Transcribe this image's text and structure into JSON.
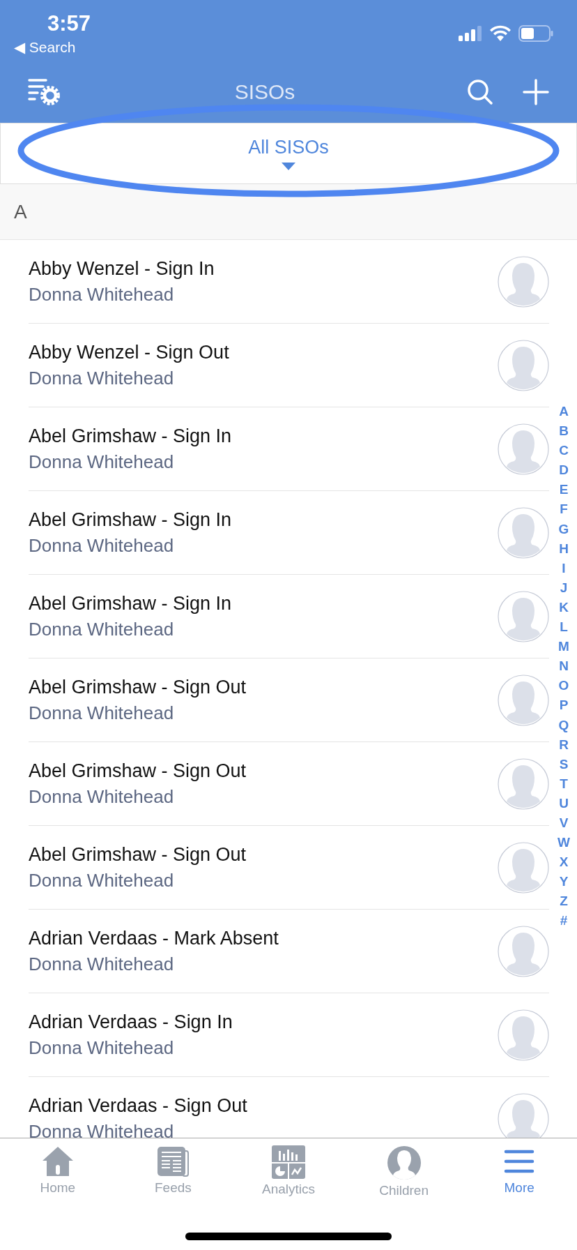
{
  "status_bar": {
    "time": "3:57",
    "back_label": "◀ Search"
  },
  "nav_bar": {
    "title": "SISOs"
  },
  "filter": {
    "label": "All SISOs"
  },
  "section": {
    "letter": "A"
  },
  "rows": [
    {
      "title": "Abby Wenzel - Sign In",
      "subtitle": "Donna Whitehead"
    },
    {
      "title": "Abby Wenzel - Sign Out",
      "subtitle": "Donna Whitehead"
    },
    {
      "title": "Abel Grimshaw - Sign In",
      "subtitle": "Donna Whitehead"
    },
    {
      "title": "Abel Grimshaw - Sign In",
      "subtitle": "Donna Whitehead"
    },
    {
      "title": "Abel Grimshaw - Sign In",
      "subtitle": "Donna Whitehead"
    },
    {
      "title": "Abel Grimshaw - Sign Out",
      "subtitle": "Donna Whitehead"
    },
    {
      "title": "Abel Grimshaw - Sign Out",
      "subtitle": "Donna Whitehead"
    },
    {
      "title": "Abel Grimshaw - Sign Out",
      "subtitle": "Donna Whitehead"
    },
    {
      "title": "Adrian Verdaas - Mark Absent",
      "subtitle": "Donna Whitehead"
    },
    {
      "title": "Adrian Verdaas - Sign In",
      "subtitle": "Donna Whitehead"
    },
    {
      "title": "Adrian Verdaas - Sign Out",
      "subtitle": "Donna Whitehead"
    }
  ],
  "index": [
    "A",
    "B",
    "C",
    "D",
    "E",
    "F",
    "G",
    "H",
    "I",
    "J",
    "K",
    "L",
    "M",
    "N",
    "O",
    "P",
    "Q",
    "R",
    "S",
    "T",
    "U",
    "V",
    "W",
    "X",
    "Y",
    "Z",
    "#"
  ],
  "tabs": [
    {
      "kind": "home",
      "label": "Home",
      "selected": false
    },
    {
      "kind": "feeds",
      "label": "Feeds",
      "selected": false
    },
    {
      "kind": "analytics",
      "label": "Analytics",
      "selected": false
    },
    {
      "kind": "children",
      "label": "Children",
      "selected": false
    },
    {
      "kind": "more",
      "label": "More",
      "selected": true
    }
  ]
}
